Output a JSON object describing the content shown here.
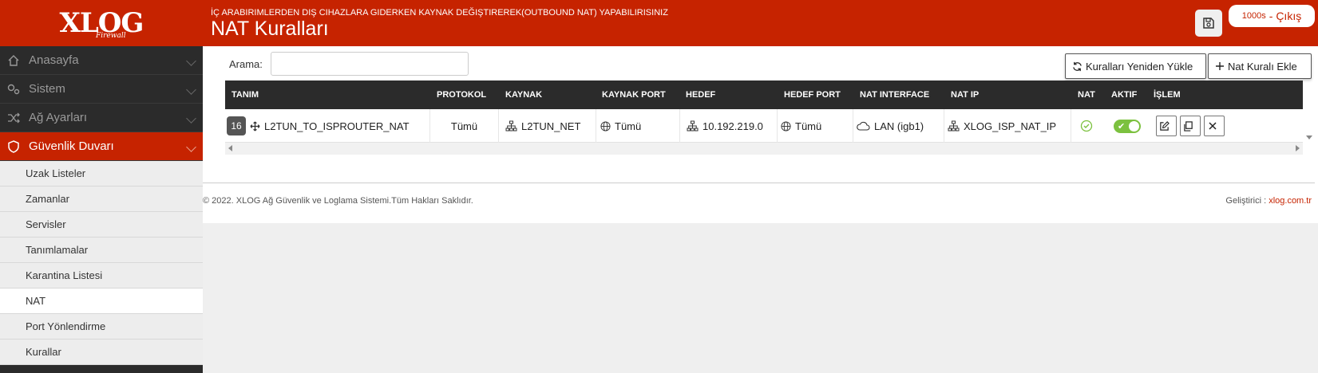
{
  "logo": {
    "main": "XLOG",
    "sub": "Firewall"
  },
  "header": {
    "subtitle": "İÇ ARABIRIMLERDEN DIŞ CIHAZLARA GIDERKEN KAYNAK DEĞIŞTIREREK(OUTBOUND NAT) YAPABILIRISINIZ",
    "title": "NAT Kuralları",
    "timer": "1000s",
    "logout_label": "- Çıkış"
  },
  "sidebar": {
    "items": [
      {
        "label": "Anasayfa",
        "icon": "home-icon"
      },
      {
        "label": "Sistem",
        "icon": "gears-icon"
      },
      {
        "label": "Ağ Ayarları",
        "icon": "shuffle-icon"
      },
      {
        "label": "Güvenlik Duvarı",
        "icon": "shield-icon"
      }
    ],
    "subitems": [
      {
        "label": "Uzak Listeler"
      },
      {
        "label": "Zamanlar"
      },
      {
        "label": "Servisler"
      },
      {
        "label": "Tanımlamalar"
      },
      {
        "label": "Karantina Listesi"
      },
      {
        "label": "NAT"
      },
      {
        "label": "Port Yönlendirme"
      },
      {
        "label": "Kurallar"
      }
    ],
    "active_subitem": "NAT"
  },
  "toolbar": {
    "search_label": "Arama:",
    "search_value": "",
    "reload_label": "Kuralları Yeniden Yükle",
    "add_label": "Nat Kuralı Ekle"
  },
  "table": {
    "columns": [
      "TANIM",
      "PROTOKOL",
      "KAYNAK",
      "KAYNAK PORT",
      "HEDEF",
      "HEDEF PORT",
      "NAT INTERFACE",
      "NAT IP",
      "NAT",
      "AKTIF",
      "İŞLEM"
    ],
    "rows": [
      {
        "order": "16",
        "name": "L2TUN_TO_ISPROUTER_NAT",
        "protocol": "Tümü",
        "source": "L2TUN_NET",
        "source_port": "Tümü",
        "destination": "10.192.219.0",
        "destination_port": "Tümü",
        "nat_interface": "LAN (igb1)",
        "nat_ip": "XLOG_ISP_NAT_IP",
        "nat": true,
        "active": true
      }
    ]
  },
  "footer": {
    "copyright": "© 2022. XLOG Ağ Güvenlik ve Loglama Sistemi.Tüm Hakları Saklıdır.",
    "developer_label": "Geliştirici :",
    "developer_link": "xlog.com.tr"
  },
  "colors": {
    "brand": "#c62300",
    "sidebar": "#2b2b2b",
    "toggle_on": "#7cc13f"
  }
}
